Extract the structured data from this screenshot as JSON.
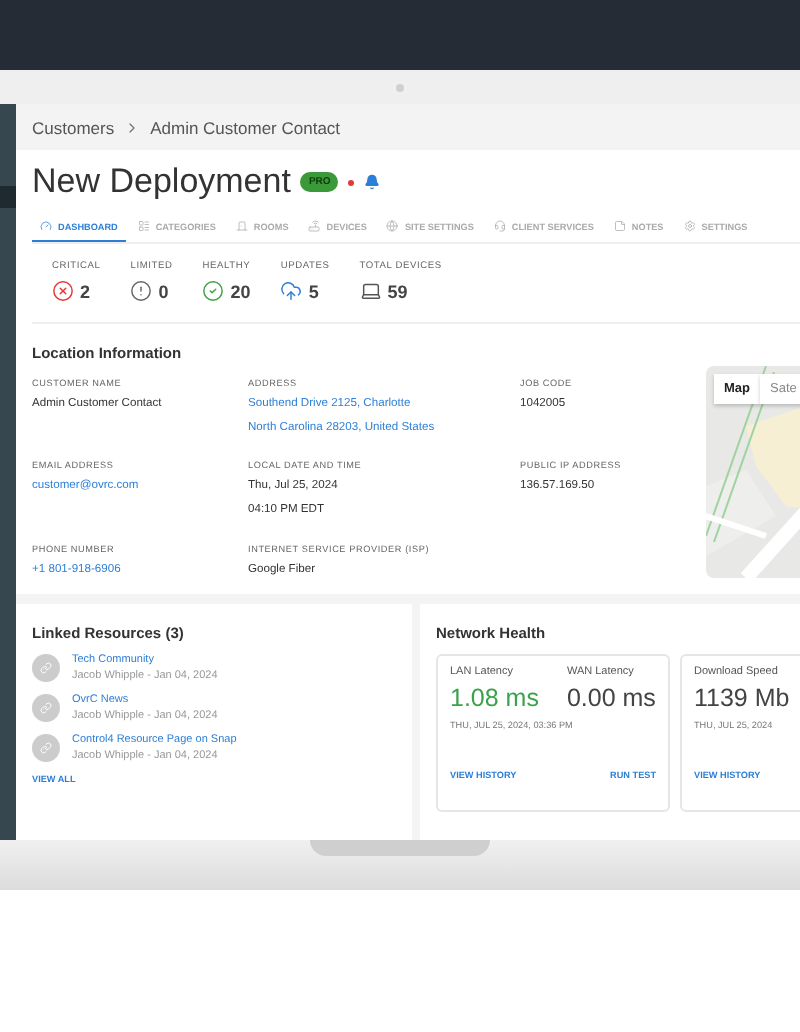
{
  "breadcrumb": [
    "Customers",
    "Admin Customer Contact"
  ],
  "title": "New Deployment",
  "badge": "PRO",
  "tabs": [
    {
      "label": "DASHBOARD",
      "kind": "dashboard",
      "selected": true
    },
    {
      "label": "CATEGORIES",
      "kind": "categories",
      "selected": false
    },
    {
      "label": "ROOMS",
      "kind": "rooms",
      "selected": false
    },
    {
      "label": "DEVICES",
      "kind": "devices",
      "selected": false
    },
    {
      "label": "SITE SETTINGS",
      "kind": "site",
      "selected": false
    },
    {
      "label": "CLIENT SERVICES",
      "kind": "services",
      "selected": false
    },
    {
      "label": "NOTES",
      "kind": "notes",
      "selected": false
    },
    {
      "label": "SETTINGS",
      "kind": "settings",
      "selected": false
    }
  ],
  "stats": [
    {
      "label": "CRITICAL",
      "value": "2",
      "kind": "critical"
    },
    {
      "label": "LIMITED",
      "value": "0",
      "kind": "limited"
    },
    {
      "label": "HEALTHY",
      "value": "20",
      "kind": "healthy"
    },
    {
      "label": "UPDATES",
      "value": "5",
      "kind": "updates"
    },
    {
      "label": "TOTAL DEVICES",
      "value": "59",
      "kind": "devices"
    }
  ],
  "location": {
    "title": "Location Information",
    "fields": [
      {
        "label": "CUSTOMER NAME",
        "kind": "text",
        "lines": [
          "Admin Customer Contact"
        ]
      },
      {
        "label": "ADDRESS",
        "kind": "link",
        "lines": [
          "Southend Drive 2125, Charlotte",
          "North Carolina 28203, United States"
        ]
      },
      {
        "label": "JOB CODE",
        "kind": "text",
        "lines": [
          "1042005"
        ]
      },
      {
        "label": "EMAIL ADDRESS",
        "kind": "link",
        "lines": [
          "customer@ovrc.com"
        ]
      },
      {
        "label": "LOCAL DATE AND TIME",
        "kind": "text",
        "lines": [
          "Thu, Jul 25, 2024",
          "04:10 PM EDT"
        ]
      },
      {
        "label": "PUBLIC IP ADDRESS",
        "kind": "text",
        "lines": [
          "136.57.169.50"
        ]
      },
      {
        "label": "PHONE NUMBER",
        "kind": "link",
        "lines": [
          "+1 801-918-6906"
        ]
      },
      {
        "label": "INTERNET SERVICE PROVIDER (ISP)",
        "kind": "text",
        "lines": [
          "Google Fiber"
        ]
      }
    ],
    "map": {
      "buttons": [
        {
          "label": "Map",
          "selected": true
        },
        {
          "label": "Sate",
          "selected": false
        }
      ]
    }
  },
  "resources": {
    "title": "Linked Resources (3)",
    "items": [
      {
        "title": "Tech Community",
        "meta": "Jacob Whipple - Jan 04, 2024"
      },
      {
        "title": "OvrC News",
        "meta": "Jacob Whipple - Jan 04, 2024"
      },
      {
        "title": "Control4 Resource Page on Snap",
        "meta": "Jacob Whipple - Jan 04, 2024"
      }
    ],
    "footer": "VIEW ALL"
  },
  "network": {
    "title": "Network Health",
    "cards": [
      {
        "metrics": [
          {
            "label": "LAN Latency",
            "value": "1.08 ms",
            "kind": "good"
          },
          {
            "label": "WAN Latency",
            "value": "0.00 ms",
            "kind": "neutral"
          }
        ],
        "timestamp": "THU, JUL 25, 2024, 03:36 PM",
        "actions": [
          "VIEW HISTORY",
          "RUN TEST"
        ]
      },
      {
        "metrics": [
          {
            "label": "Download Speed",
            "value": "1139 Mb",
            "kind": "neutral"
          }
        ],
        "timestamp": "THU, JUL 25, 2024",
        "actions": [
          "VIEW HISTORY"
        ]
      }
    ]
  }
}
